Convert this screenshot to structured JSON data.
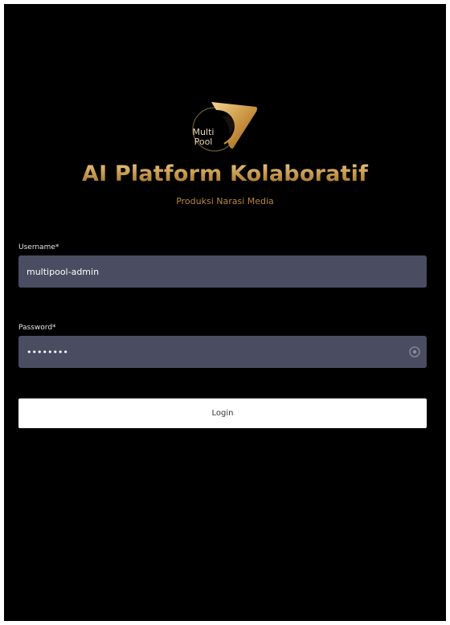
{
  "brand": {
    "logo_text_line1": "Multi",
    "logo_text_line2": "Pool",
    "title": "AI Platform Kolaboratif",
    "subtitle": "Produksi Narasi Media",
    "colors": {
      "gold": "#c9a05a",
      "gold_light": "#e9c987",
      "gold_dark": "#9b6c2c",
      "background": "#000000",
      "field_bg": "#4a4c61"
    }
  },
  "form": {
    "username": {
      "label": "Username*",
      "value": "multipool-admin"
    },
    "password": {
      "label": "Password*",
      "value": "••••••••",
      "toggle_icon": "eye-icon"
    },
    "login_label": "Login"
  }
}
